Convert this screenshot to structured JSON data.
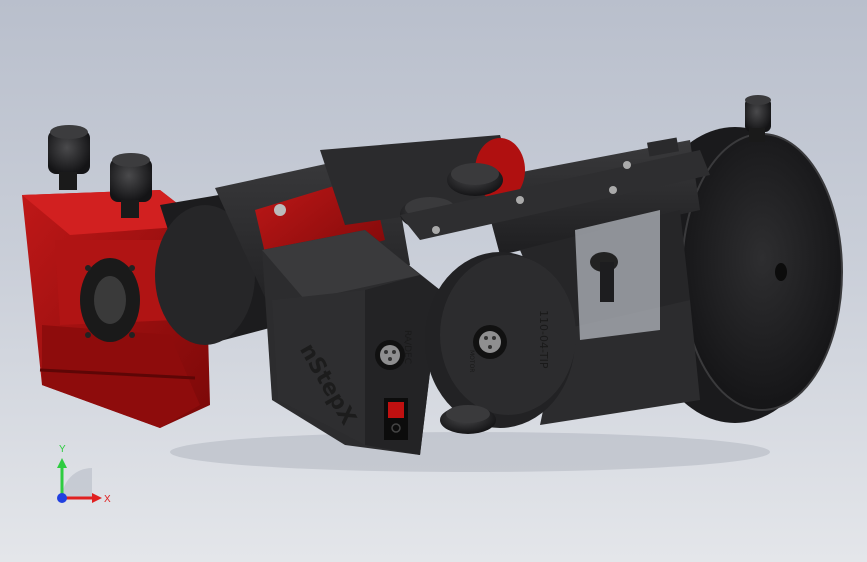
{
  "model": {
    "logo_text": "nStepX",
    "connector_label": "RA/DEC",
    "motor_label": "110-04-TIP",
    "motor_small_label": "MOTOR"
  },
  "triad": {
    "y_label": "Y",
    "x_label": "X"
  },
  "colors": {
    "background_top": "#b9bfcc",
    "background_bottom": "#e4e6ea",
    "body_black": "#2a2a2c",
    "accent_red": "#a01010",
    "axis_y": "#2ecc40",
    "axis_x": "#e02020",
    "axis_z": "#2040e0"
  }
}
